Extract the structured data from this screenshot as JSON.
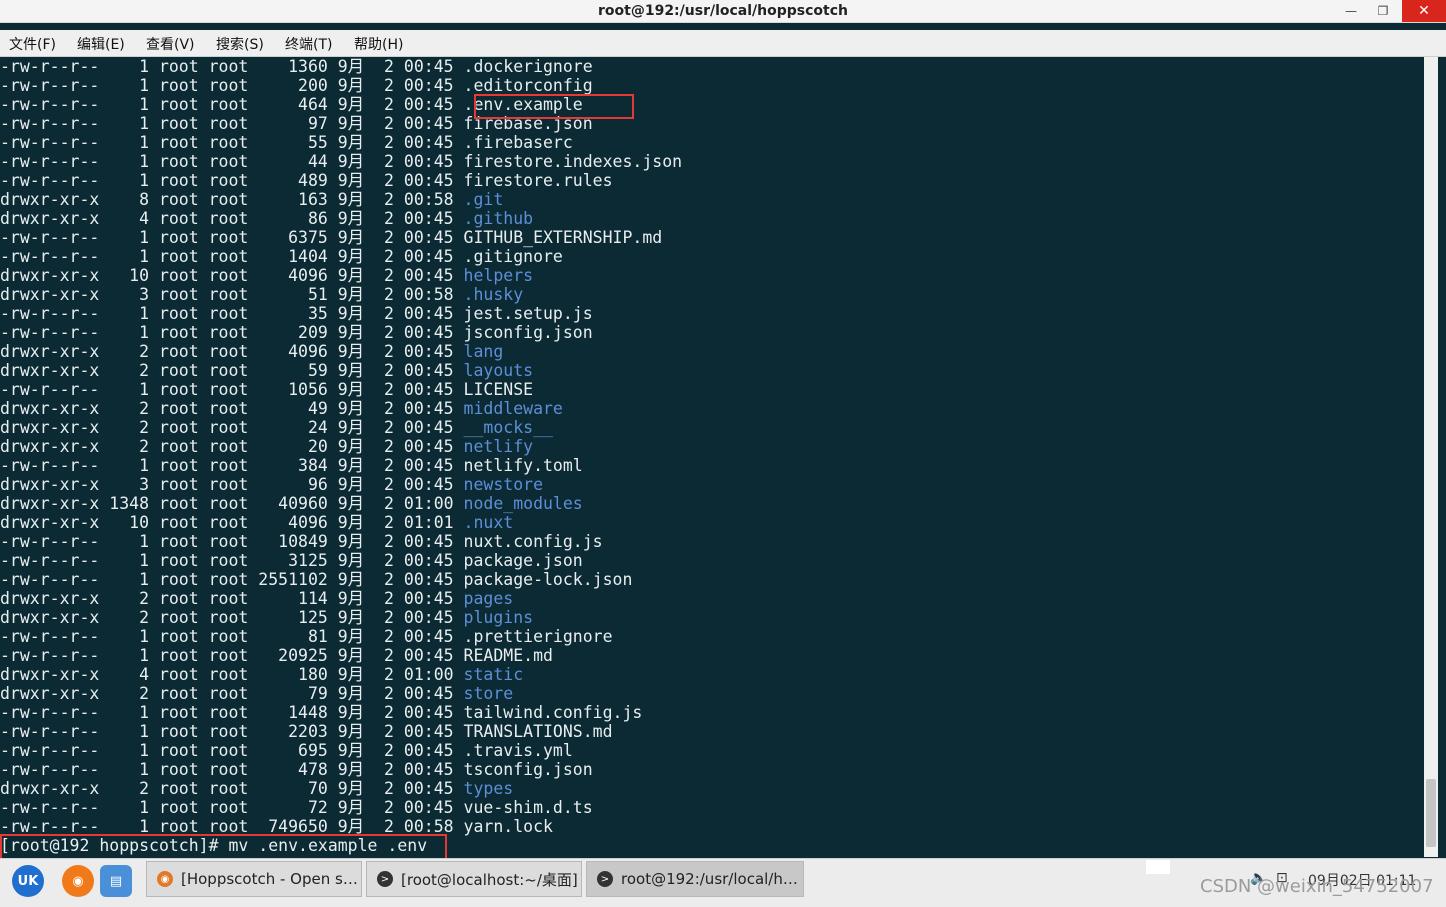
{
  "window": {
    "title": "root@192:/usr/local/hoppscotch",
    "minimize_glyph": "—",
    "maximize_glyph": "❐",
    "close_glyph": "✕"
  },
  "menu": [
    "文件(F)",
    "编辑(E)",
    "查看(V)",
    "搜索(S)",
    "终端(T)",
    "帮助(H)"
  ],
  "listing": [
    {
      "perm": "-rw-r--r--",
      "links": "1",
      "owner": "root",
      "group": "root",
      "size": "1360",
      "month": "9月",
      "day": "2",
      "time": "00:45",
      "name": ".dockerignore",
      "dir": false
    },
    {
      "perm": "-rw-r--r--",
      "links": "1",
      "owner": "root",
      "group": "root",
      "size": "200",
      "month": "9月",
      "day": "2",
      "time": "00:45",
      "name": ".editorconfig",
      "dir": false
    },
    {
      "perm": "-rw-r--r--",
      "links": "1",
      "owner": "root",
      "group": "root",
      "size": "464",
      "month": "9月",
      "day": "2",
      "time": "00:45",
      "name": ".env.example",
      "dir": false
    },
    {
      "perm": "-rw-r--r--",
      "links": "1",
      "owner": "root",
      "group": "root",
      "size": "97",
      "month": "9月",
      "day": "2",
      "time": "00:45",
      "name": "firebase.json",
      "dir": false
    },
    {
      "perm": "-rw-r--r--",
      "links": "1",
      "owner": "root",
      "group": "root",
      "size": "55",
      "month": "9月",
      "day": "2",
      "time": "00:45",
      "name": ".firebaserc",
      "dir": false
    },
    {
      "perm": "-rw-r--r--",
      "links": "1",
      "owner": "root",
      "group": "root",
      "size": "44",
      "month": "9月",
      "day": "2",
      "time": "00:45",
      "name": "firestore.indexes.json",
      "dir": false
    },
    {
      "perm": "-rw-r--r--",
      "links": "1",
      "owner": "root",
      "group": "root",
      "size": "489",
      "month": "9月",
      "day": "2",
      "time": "00:45",
      "name": "firestore.rules",
      "dir": false
    },
    {
      "perm": "drwxr-xr-x",
      "links": "8",
      "owner": "root",
      "group": "root",
      "size": "163",
      "month": "9月",
      "day": "2",
      "time": "00:58",
      "name": ".git",
      "dir": true
    },
    {
      "perm": "drwxr-xr-x",
      "links": "4",
      "owner": "root",
      "group": "root",
      "size": "86",
      "month": "9月",
      "day": "2",
      "time": "00:45",
      "name": ".github",
      "dir": true
    },
    {
      "perm": "-rw-r--r--",
      "links": "1",
      "owner": "root",
      "group": "root",
      "size": "6375",
      "month": "9月",
      "day": "2",
      "time": "00:45",
      "name": "GITHUB_EXTERNSHIP.md",
      "dir": false
    },
    {
      "perm": "-rw-r--r--",
      "links": "1",
      "owner": "root",
      "group": "root",
      "size": "1404",
      "month": "9月",
      "day": "2",
      "time": "00:45",
      "name": ".gitignore",
      "dir": false
    },
    {
      "perm": "drwxr-xr-x",
      "links": "10",
      "owner": "root",
      "group": "root",
      "size": "4096",
      "month": "9月",
      "day": "2",
      "time": "00:45",
      "name": "helpers",
      "dir": true
    },
    {
      "perm": "drwxr-xr-x",
      "links": "3",
      "owner": "root",
      "group": "root",
      "size": "51",
      "month": "9月",
      "day": "2",
      "time": "00:58",
      "name": ".husky",
      "dir": true
    },
    {
      "perm": "-rw-r--r--",
      "links": "1",
      "owner": "root",
      "group": "root",
      "size": "35",
      "month": "9月",
      "day": "2",
      "time": "00:45",
      "name": "jest.setup.js",
      "dir": false
    },
    {
      "perm": "-rw-r--r--",
      "links": "1",
      "owner": "root",
      "group": "root",
      "size": "209",
      "month": "9月",
      "day": "2",
      "time": "00:45",
      "name": "jsconfig.json",
      "dir": false
    },
    {
      "perm": "drwxr-xr-x",
      "links": "2",
      "owner": "root",
      "group": "root",
      "size": "4096",
      "month": "9月",
      "day": "2",
      "time": "00:45",
      "name": "lang",
      "dir": true
    },
    {
      "perm": "drwxr-xr-x",
      "links": "2",
      "owner": "root",
      "group": "root",
      "size": "59",
      "month": "9月",
      "day": "2",
      "time": "00:45",
      "name": "layouts",
      "dir": true
    },
    {
      "perm": "-rw-r--r--",
      "links": "1",
      "owner": "root",
      "group": "root",
      "size": "1056",
      "month": "9月",
      "day": "2",
      "time": "00:45",
      "name": "LICENSE",
      "dir": false
    },
    {
      "perm": "drwxr-xr-x",
      "links": "2",
      "owner": "root",
      "group": "root",
      "size": "49",
      "month": "9月",
      "day": "2",
      "time": "00:45",
      "name": "middleware",
      "dir": true
    },
    {
      "perm": "drwxr-xr-x",
      "links": "2",
      "owner": "root",
      "group": "root",
      "size": "24",
      "month": "9月",
      "day": "2",
      "time": "00:45",
      "name": "__mocks__",
      "dir": true
    },
    {
      "perm": "drwxr-xr-x",
      "links": "2",
      "owner": "root",
      "group": "root",
      "size": "20",
      "month": "9月",
      "day": "2",
      "time": "00:45",
      "name": "netlify",
      "dir": true
    },
    {
      "perm": "-rw-r--r--",
      "links": "1",
      "owner": "root",
      "group": "root",
      "size": "384",
      "month": "9月",
      "day": "2",
      "time": "00:45",
      "name": "netlify.toml",
      "dir": false
    },
    {
      "perm": "drwxr-xr-x",
      "links": "3",
      "owner": "root",
      "group": "root",
      "size": "96",
      "month": "9月",
      "day": "2",
      "time": "00:45",
      "name": "newstore",
      "dir": true
    },
    {
      "perm": "drwxr-xr-x",
      "links": "1348",
      "owner": "root",
      "group": "root",
      "size": "40960",
      "month": "9月",
      "day": "2",
      "time": "01:00",
      "name": "node_modules",
      "dir": true
    },
    {
      "perm": "drwxr-xr-x",
      "links": "10",
      "owner": "root",
      "group": "root",
      "size": "4096",
      "month": "9月",
      "day": "2",
      "time": "01:01",
      "name": ".nuxt",
      "dir": true
    },
    {
      "perm": "-rw-r--r--",
      "links": "1",
      "owner": "root",
      "group": "root",
      "size": "10849",
      "month": "9月",
      "day": "2",
      "time": "00:45",
      "name": "nuxt.config.js",
      "dir": false
    },
    {
      "perm": "-rw-r--r--",
      "links": "1",
      "owner": "root",
      "group": "root",
      "size": "3125",
      "month": "9月",
      "day": "2",
      "time": "00:45",
      "name": "package.json",
      "dir": false
    },
    {
      "perm": "-rw-r--r--",
      "links": "1",
      "owner": "root",
      "group": "root",
      "size": "2551102",
      "month": "9月",
      "day": "2",
      "time": "00:45",
      "name": "package-lock.json",
      "dir": false
    },
    {
      "perm": "drwxr-xr-x",
      "links": "2",
      "owner": "root",
      "group": "root",
      "size": "114",
      "month": "9月",
      "day": "2",
      "time": "00:45",
      "name": "pages",
      "dir": true
    },
    {
      "perm": "drwxr-xr-x",
      "links": "2",
      "owner": "root",
      "group": "root",
      "size": "125",
      "month": "9月",
      "day": "2",
      "time": "00:45",
      "name": "plugins",
      "dir": true
    },
    {
      "perm": "-rw-r--r--",
      "links": "1",
      "owner": "root",
      "group": "root",
      "size": "81",
      "month": "9月",
      "day": "2",
      "time": "00:45",
      "name": ".prettierignore",
      "dir": false
    },
    {
      "perm": "-rw-r--r--",
      "links": "1",
      "owner": "root",
      "group": "root",
      "size": "20925",
      "month": "9月",
      "day": "2",
      "time": "00:45",
      "name": "README.md",
      "dir": false
    },
    {
      "perm": "drwxr-xr-x",
      "links": "4",
      "owner": "root",
      "group": "root",
      "size": "180",
      "month": "9月",
      "day": "2",
      "time": "01:00",
      "name": "static",
      "dir": true
    },
    {
      "perm": "drwxr-xr-x",
      "links": "2",
      "owner": "root",
      "group": "root",
      "size": "79",
      "month": "9月",
      "day": "2",
      "time": "00:45",
      "name": "store",
      "dir": true
    },
    {
      "perm": "-rw-r--r--",
      "links": "1",
      "owner": "root",
      "group": "root",
      "size": "1448",
      "month": "9月",
      "day": "2",
      "time": "00:45",
      "name": "tailwind.config.js",
      "dir": false
    },
    {
      "perm": "-rw-r--r--",
      "links": "1",
      "owner": "root",
      "group": "root",
      "size": "2203",
      "month": "9月",
      "day": "2",
      "time": "00:45",
      "name": "TRANSLATIONS.md",
      "dir": false
    },
    {
      "perm": "-rw-r--r--",
      "links": "1",
      "owner": "root",
      "group": "root",
      "size": "695",
      "month": "9月",
      "day": "2",
      "time": "00:45",
      "name": ".travis.yml",
      "dir": false
    },
    {
      "perm": "-rw-r--r--",
      "links": "1",
      "owner": "root",
      "group": "root",
      "size": "478",
      "month": "9月",
      "day": "2",
      "time": "00:45",
      "name": "tsconfig.json",
      "dir": false
    },
    {
      "perm": "drwxr-xr-x",
      "links": "2",
      "owner": "root",
      "group": "root",
      "size": "70",
      "month": "9月",
      "day": "2",
      "time": "00:45",
      "name": "types",
      "dir": true
    },
    {
      "perm": "-rw-r--r--",
      "links": "1",
      "owner": "root",
      "group": "root",
      "size": "72",
      "month": "9月",
      "day": "2",
      "time": "00:45",
      "name": "vue-shim.d.ts",
      "dir": false
    },
    {
      "perm": "-rw-r--r--",
      "links": "1",
      "owner": "root",
      "group": "root",
      "size": "749650",
      "month": "9月",
      "day": "2",
      "time": "00:58",
      "name": "yarn.lock",
      "dir": false
    }
  ],
  "prompt": {
    "text": "[root@192 hoppscotch]# mv .env.example .env"
  },
  "taskbar": {
    "launchers": [
      {
        "name": "start-menu-icon",
        "glyph": "UK",
        "color": "#1e6fd0"
      },
      {
        "name": "firefox-icon",
        "glyph": "◉",
        "color": "#f07a1a"
      },
      {
        "name": "file-manager-icon",
        "glyph": "▤",
        "color": "#4a90d9"
      }
    ],
    "tasks": [
      {
        "label": "[Hoppscotch - Open s…",
        "icon": "firefox-icon",
        "icon_color": "#e07a2a",
        "icon_glyph": "◉"
      },
      {
        "label": "[root@localhost:~/桌面]",
        "icon": "terminal-icon",
        "icon_color": "#333333",
        "icon_glyph": ">"
      },
      {
        "label": "root@192:/usr/local/h…",
        "icon": "terminal-icon",
        "icon_color": "#333333",
        "icon_glyph": ">"
      }
    ],
    "clock": "09月02日 01:11",
    "volume_glyph": "🔈",
    "network_glyph": "⊡"
  },
  "watermark": "CSDN @weixin_54752007",
  "colors": {
    "terminal_bg": "#0b2a33",
    "terminal_fg": "#e8eef0",
    "directory": "#5d8fd6",
    "highlight": "#e53935"
  }
}
